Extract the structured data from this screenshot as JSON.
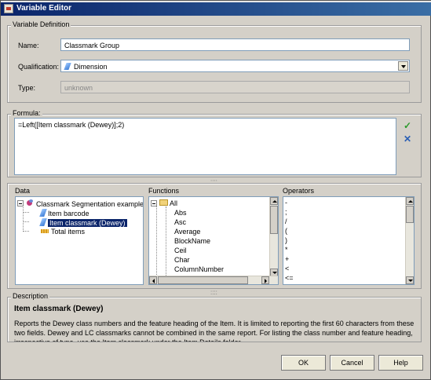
{
  "window": {
    "title": "Variable Editor"
  },
  "variable_definition": {
    "group_label": "Variable Definition",
    "name_label": "Name:",
    "name_value": "Classmark Group",
    "qualification_label": "Qualification:",
    "qualification_value": "Dimension",
    "type_label": "Type:",
    "type_value": "unknown"
  },
  "formula": {
    "group_label": "Formula:",
    "value": "=Left([Item classmark (Dewey)];2)",
    "validate_icon": "checkmark-icon",
    "clear_icon": "x-icon"
  },
  "data_panel": {
    "title": "Data",
    "items": [
      {
        "label": "Classmark Segmentation example",
        "icon": "document-icon"
      },
      {
        "label": "Item barcode",
        "icon": "dimension-icon"
      },
      {
        "label": "Item classmark (Dewey)",
        "icon": "dimension-icon",
        "selected": true
      },
      {
        "label": "Total items",
        "icon": "measure-icon"
      }
    ]
  },
  "functions_panel": {
    "title": "Functions",
    "root": "All",
    "items": [
      "Abs",
      "Asc",
      "Average",
      "BlockName",
      "Ceil",
      "Char",
      "ColumnNumber"
    ]
  },
  "operators_panel": {
    "title": "Operators",
    "items": [
      "-",
      ";",
      "/",
      "(",
      ")",
      "*",
      "+",
      "<",
      "<="
    ]
  },
  "description": {
    "group_label": "Description",
    "title": "Item classmark (Dewey)",
    "text": "Reports the Dewey class numbers and the feature heading of the Item. It is limited to reporting the first 60 characters from these two fields.  Dewey and LC classmarks cannot be combined in the same report. For listing the class number and feature heading, irrespective of type, use the Item classmark under the Item Details folder."
  },
  "buttons": {
    "ok": "OK",
    "cancel": "Cancel",
    "help": "Help"
  }
}
